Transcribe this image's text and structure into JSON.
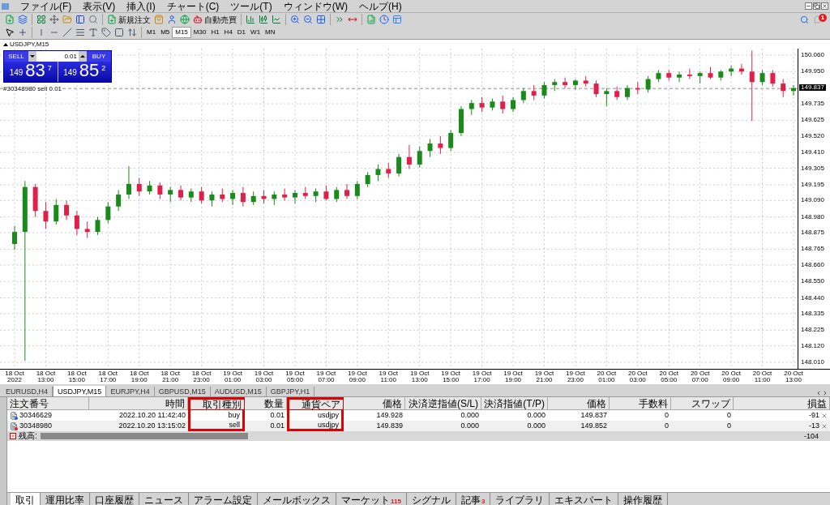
{
  "menu": [
    "ファイル(F)",
    "表示(V)",
    "挿入(I)",
    "チャート(C)",
    "ツール(T)",
    "ウィンドウ(W)",
    "ヘルプ(H)"
  ],
  "toolbar_buttons": [
    "新規注文",
    "自動売買"
  ],
  "notifications": "1",
  "timeframes": [
    {
      "label": "M1",
      "selected": false
    },
    {
      "label": "M5",
      "selected": false
    },
    {
      "label": "M15",
      "selected": true
    },
    {
      "label": "M30",
      "selected": false
    },
    {
      "label": "H1",
      "selected": false
    },
    {
      "label": "H4",
      "selected": false
    },
    {
      "label": "D1",
      "selected": false
    },
    {
      "label": "W1",
      "selected": false
    },
    {
      "label": "MN",
      "selected": false
    }
  ],
  "chart": {
    "title": "USDJPY,M15",
    "trade_panel": {
      "sell_label": "SELL",
      "buy_label": "BUY",
      "lot": "0.01",
      "sell_price": {
        "prefix": "149",
        "main": "83",
        "suffix": "7"
      },
      "buy_price": {
        "prefix": "149",
        "main": "85",
        "suffix": "2"
      }
    },
    "order_label": "#30348980 sell 0.01",
    "current_price": "149.837",
    "chart_data": {
      "type": "candlestick",
      "ylim": [
        147.967,
        150.103
      ],
      "grid": true,
      "ref_lines": [
        {
          "axis": "y",
          "value": 149.837
        }
      ],
      "yticks": [
        {
          "value": 150.06,
          "label": "150.060"
        },
        {
          "value": 149.95,
          "label": "149.950"
        },
        {
          "value": 149.735,
          "label": "149.735"
        },
        {
          "value": 149.625,
          "label": "149.625"
        },
        {
          "value": 149.52,
          "label": "149.520"
        },
        {
          "value": 149.41,
          "label": "149.410"
        },
        {
          "value": 149.305,
          "label": "149.305"
        },
        {
          "value": 149.195,
          "label": "149.195"
        },
        {
          "value": 149.09,
          "label": "149.090"
        },
        {
          "value": 148.98,
          "label": "148.980"
        },
        {
          "value": 148.875,
          "label": "148.875"
        },
        {
          "value": 148.765,
          "label": "148.765"
        },
        {
          "value": 148.66,
          "label": "148.660"
        },
        {
          "value": 148.55,
          "label": "148.550"
        },
        {
          "value": 148.44,
          "label": "148.440"
        },
        {
          "value": 148.335,
          "label": "148.335"
        },
        {
          "value": 148.225,
          "label": "148.225"
        },
        {
          "value": 148.12,
          "label": "148.120"
        },
        {
          "value": 148.01,
          "label": "148.010"
        }
      ],
      "categories": [
        "18 Oct 2022",
        null,
        null,
        "18 Oct 13:00",
        null,
        null,
        "18 Oct 15:00",
        null,
        null,
        "18 Oct 17:00",
        null,
        null,
        "18 Oct 19:00",
        null,
        null,
        "18 Oct 21:00",
        null,
        null,
        "18 Oct 23:00",
        null,
        null,
        "19 Oct 01:00",
        null,
        null,
        "19 Oct 03:00",
        null,
        null,
        "19 Oct 05:00",
        null,
        null,
        "19 Oct 07:00",
        null,
        null,
        "19 Oct 09:00",
        null,
        null,
        "19 Oct 11:00",
        null,
        null,
        "19 Oct 13:00",
        null,
        null,
        "19 Oct 15:00",
        null,
        null,
        "19 Oct 17:00",
        null,
        null,
        "19 Oct 19:00",
        null,
        null,
        "19 Oct 21:00",
        null,
        null,
        "19 Oct 23:00",
        null,
        null,
        "20 Oct 01:00",
        null,
        null,
        "20 Oct 03:00",
        null,
        null,
        "20 Oct 05:00",
        null,
        null,
        "20 Oct 07:00",
        null,
        null,
        "20 Oct 09:00",
        null,
        null,
        "20 Oct 11:00",
        null,
        null,
        "20 Oct 13:00"
      ],
      "ohlc": [
        [
          148.8,
          148.92,
          148.76,
          148.88
        ],
        [
          148.88,
          149.22,
          148.02,
          149.18
        ],
        [
          149.18,
          149.2,
          148.98,
          149.02
        ],
        [
          149.02,
          149.08,
          148.9,
          148.95
        ],
        [
          148.95,
          149.1,
          148.93,
          149.06
        ],
        [
          149.06,
          149.09,
          148.96,
          148.99
        ],
        [
          148.99,
          149.02,
          148.86,
          148.9
        ],
        [
          148.9,
          148.95,
          148.84,
          148.88
        ],
        [
          148.88,
          148.98,
          148.86,
          148.96
        ],
        [
          148.96,
          149.08,
          148.94,
          149.05
        ],
        [
          149.05,
          149.16,
          149.02,
          149.13
        ],
        [
          149.13,
          149.32,
          149.1,
          149.2
        ],
        [
          149.2,
          149.24,
          149.12,
          149.15
        ],
        [
          149.15,
          149.22,
          149.13,
          149.19
        ],
        [
          149.19,
          149.21,
          149.1,
          149.13
        ],
        [
          149.13,
          149.18,
          149.08,
          149.16
        ],
        [
          149.16,
          149.19,
          149.09,
          149.11
        ],
        [
          149.11,
          149.17,
          149.08,
          149.15
        ],
        [
          149.15,
          149.18,
          149.07,
          149.09
        ],
        [
          149.09,
          149.15,
          149.05,
          149.13
        ],
        [
          149.13,
          149.17,
          149.08,
          149.1
        ],
        [
          149.1,
          149.16,
          149.06,
          149.14
        ],
        [
          149.14,
          149.18,
          149.05,
          149.08
        ],
        [
          149.08,
          149.15,
          149.06,
          149.12
        ],
        [
          149.12,
          149.16,
          149.07,
          149.1
        ],
        [
          149.1,
          149.15,
          149.06,
          149.13
        ],
        [
          149.13,
          149.17,
          149.09,
          149.11
        ],
        [
          149.11,
          149.16,
          149.07,
          149.14
        ],
        [
          149.14,
          149.18,
          149.1,
          149.12
        ],
        [
          149.12,
          149.17,
          149.08,
          149.15
        ],
        [
          149.15,
          149.19,
          149.09,
          149.1
        ],
        [
          149.1,
          149.18,
          149.08,
          149.16
        ],
        [
          149.16,
          149.2,
          149.1,
          149.12
        ],
        [
          149.12,
          149.22,
          149.1,
          149.2
        ],
        [
          149.2,
          149.28,
          149.18,
          149.26
        ],
        [
          149.26,
          149.33,
          149.22,
          149.3
        ],
        [
          149.3,
          149.34,
          149.24,
          149.27
        ],
        [
          149.27,
          149.4,
          149.25,
          149.38
        ],
        [
          149.38,
          149.46,
          149.3,
          149.33
        ],
        [
          149.33,
          149.45,
          149.31,
          149.42
        ],
        [
          149.42,
          149.5,
          149.38,
          149.47
        ],
        [
          149.47,
          149.52,
          149.4,
          149.44
        ],
        [
          149.44,
          149.56,
          149.42,
          149.54
        ],
        [
          149.54,
          149.72,
          149.52,
          149.7
        ],
        [
          149.7,
          149.76,
          149.66,
          149.74
        ],
        [
          149.74,
          149.78,
          149.68,
          149.71
        ],
        [
          149.71,
          149.77,
          149.69,
          149.75
        ],
        [
          149.75,
          149.79,
          149.67,
          149.7
        ],
        [
          149.7,
          149.78,
          149.68,
          149.76
        ],
        [
          149.76,
          149.84,
          149.74,
          149.82
        ],
        [
          149.82,
          149.86,
          149.76,
          149.79
        ],
        [
          149.79,
          149.88,
          149.77,
          149.86
        ],
        [
          149.86,
          149.9,
          149.82,
          149.88
        ],
        [
          149.88,
          149.91,
          149.84,
          149.86
        ],
        [
          149.86,
          149.9,
          149.83,
          149.89
        ],
        [
          149.89,
          149.92,
          149.85,
          149.87
        ],
        [
          149.87,
          149.89,
          149.78,
          149.8
        ],
        [
          149.8,
          149.84,
          149.72,
          149.82
        ],
        [
          149.82,
          149.85,
          149.76,
          149.78
        ],
        [
          149.78,
          149.86,
          149.76,
          149.84
        ],
        [
          149.84,
          149.88,
          149.8,
          149.83
        ],
        [
          149.83,
          149.92,
          149.81,
          149.9
        ],
        [
          149.9,
          149.96,
          149.88,
          149.94
        ],
        [
          149.94,
          149.96,
          149.89,
          149.91
        ],
        [
          149.91,
          149.95,
          149.88,
          149.93
        ],
        [
          149.93,
          149.97,
          149.9,
          149.92
        ],
        [
          149.92,
          149.95,
          149.87,
          149.94
        ],
        [
          149.94,
          149.98,
          149.9,
          149.91
        ],
        [
          149.91,
          149.96,
          149.89,
          149.95
        ],
        [
          149.95,
          149.99,
          149.92,
          149.97
        ],
        [
          149.97,
          150.0,
          149.93,
          149.95
        ],
        [
          149.95,
          150.09,
          149.62,
          149.88
        ],
        [
          149.88,
          149.96,
          149.86,
          149.94
        ],
        [
          149.94,
          149.96,
          149.85,
          149.87
        ],
        [
          149.87,
          149.9,
          149.78,
          149.82
        ],
        [
          149.82,
          149.86,
          149.79,
          149.84
        ]
      ]
    }
  },
  "chart_tabs": [
    {
      "label": "EURUSD,H4",
      "selected": false
    },
    {
      "label": "USDJPY,M15",
      "selected": true
    },
    {
      "label": "EURJPY,H4",
      "selected": false
    },
    {
      "label": "GBPUSD,M15",
      "selected": false
    },
    {
      "label": "AUDUSD,M15",
      "selected": false
    },
    {
      "label": "GBPJPY,H1",
      "selected": false
    }
  ],
  "table": {
    "columns": [
      {
        "label": "注文番号",
        "highlighted": false
      },
      {
        "label": "時間",
        "highlighted": false
      },
      {
        "label": "取引種別",
        "highlighted": true
      },
      {
        "label": "数量",
        "highlighted": false
      },
      {
        "label": "通貨ペア",
        "highlighted": true
      },
      {
        "label": "価格",
        "highlighted": false
      },
      {
        "label": "決済逆指値(S/L)",
        "highlighted": false
      },
      {
        "label": "決済指値(T/P)",
        "highlighted": false
      },
      {
        "label": "価格",
        "highlighted": false
      },
      {
        "label": "手数料",
        "highlighted": false
      },
      {
        "label": "スワップ",
        "highlighted": false
      },
      {
        "label": "損益",
        "highlighted": false
      }
    ],
    "rows": [
      {
        "kind": "buy",
        "cells": [
          "30346629",
          "2022.10.20 11:42:40",
          "buy",
          "0.01",
          "usdjpy",
          "149.928",
          "0.000",
          "0.000",
          "149.837",
          "0",
          "0",
          "-91"
        ]
      },
      {
        "kind": "sell",
        "cells": [
          "30348980",
          "2022.10.20 13:15:02",
          "sell",
          "0.01",
          "usdjpy",
          "149.839",
          "0.000",
          "0.000",
          "149.852",
          "0",
          "0",
          "-13"
        ]
      }
    ],
    "balance": {
      "label": "残高:",
      "value": "-104"
    }
  },
  "terminal_tabs": [
    {
      "label": "取引",
      "selected": true
    },
    {
      "label": "運用比率",
      "selected": false
    },
    {
      "label": "口座履歴",
      "selected": false
    },
    {
      "label": "ニュース",
      "selected": false
    },
    {
      "label": "アラーム設定",
      "selected": false
    },
    {
      "label": "メールボックス",
      "selected": false
    },
    {
      "label": "マーケット",
      "selected": false,
      "badge": "115"
    },
    {
      "label": "シグナル",
      "selected": false
    },
    {
      "label": "記事",
      "selected": false,
      "badge": "3"
    },
    {
      "label": "ライブラリ",
      "selected": false
    },
    {
      "label": "エキスパート",
      "selected": false
    },
    {
      "label": "操作履歴",
      "selected": false
    }
  ]
}
